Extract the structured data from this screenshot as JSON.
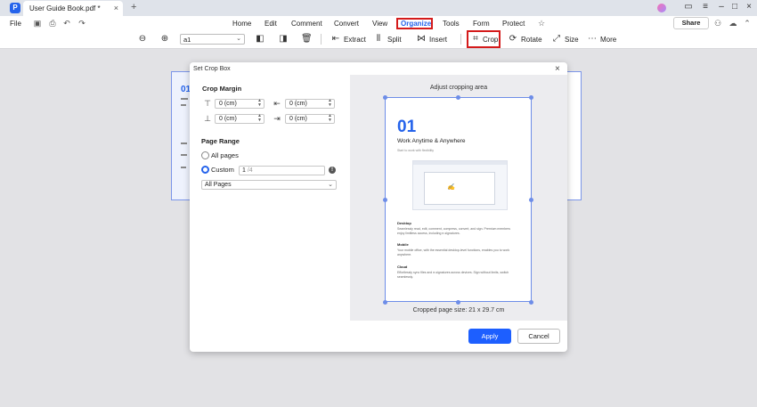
{
  "titlebar": {
    "tab_title": "User Guide Book.pdf *",
    "new_tab": "+",
    "close_tab": "×"
  },
  "menubar": {
    "file": "File",
    "items": [
      "Home",
      "Edit",
      "Comment",
      "Convert",
      "View",
      "Organize",
      "Tools",
      "Form",
      "Protect"
    ],
    "active": "Organize",
    "share": "Share"
  },
  "toolbar": {
    "zoom": "a1",
    "extract": "Extract",
    "split": "Split",
    "insert": "Insert",
    "crop": "Crop",
    "rotate": "Rotate",
    "size": "Size",
    "more": "More"
  },
  "background_page": {
    "number": "01"
  },
  "dialog": {
    "title": "Set Crop Box",
    "crop_margin": {
      "heading": "Crop Margin",
      "top": "0 (cm)",
      "left": "0 (cm)",
      "bottom": "0 (cm)",
      "right": "0 (cm)"
    },
    "page_range": {
      "heading": "Page Range",
      "all_pages": "All pages",
      "custom": "Custom",
      "custom_value": "1",
      "custom_total": "/4",
      "select_value": "All Pages"
    },
    "preview": {
      "caption": "Adjust cropping area",
      "page_number": "01",
      "page_title": "Work Anytime & Anywhere",
      "page_subtitle": "Start to work with flexibility",
      "desktop_h": "Desktop",
      "desktop_t": "Seamlessly read, edit, comment, compress, convert, and sign. Premium members enjoy limitless access, including e-signatures.",
      "mobile_h": "Mobile",
      "mobile_t": "Your mobile office, with the essential desktop-level functions, enables you to work anywhere.",
      "cloud_h": "Cloud",
      "cloud_t": "Effortlessly sync files and e-signatures across devices. Sign without limits, switch seamlessly.",
      "size_label": "Cropped page size: 21 x 29.7 cm"
    },
    "apply": "Apply",
    "cancel": "Cancel"
  }
}
